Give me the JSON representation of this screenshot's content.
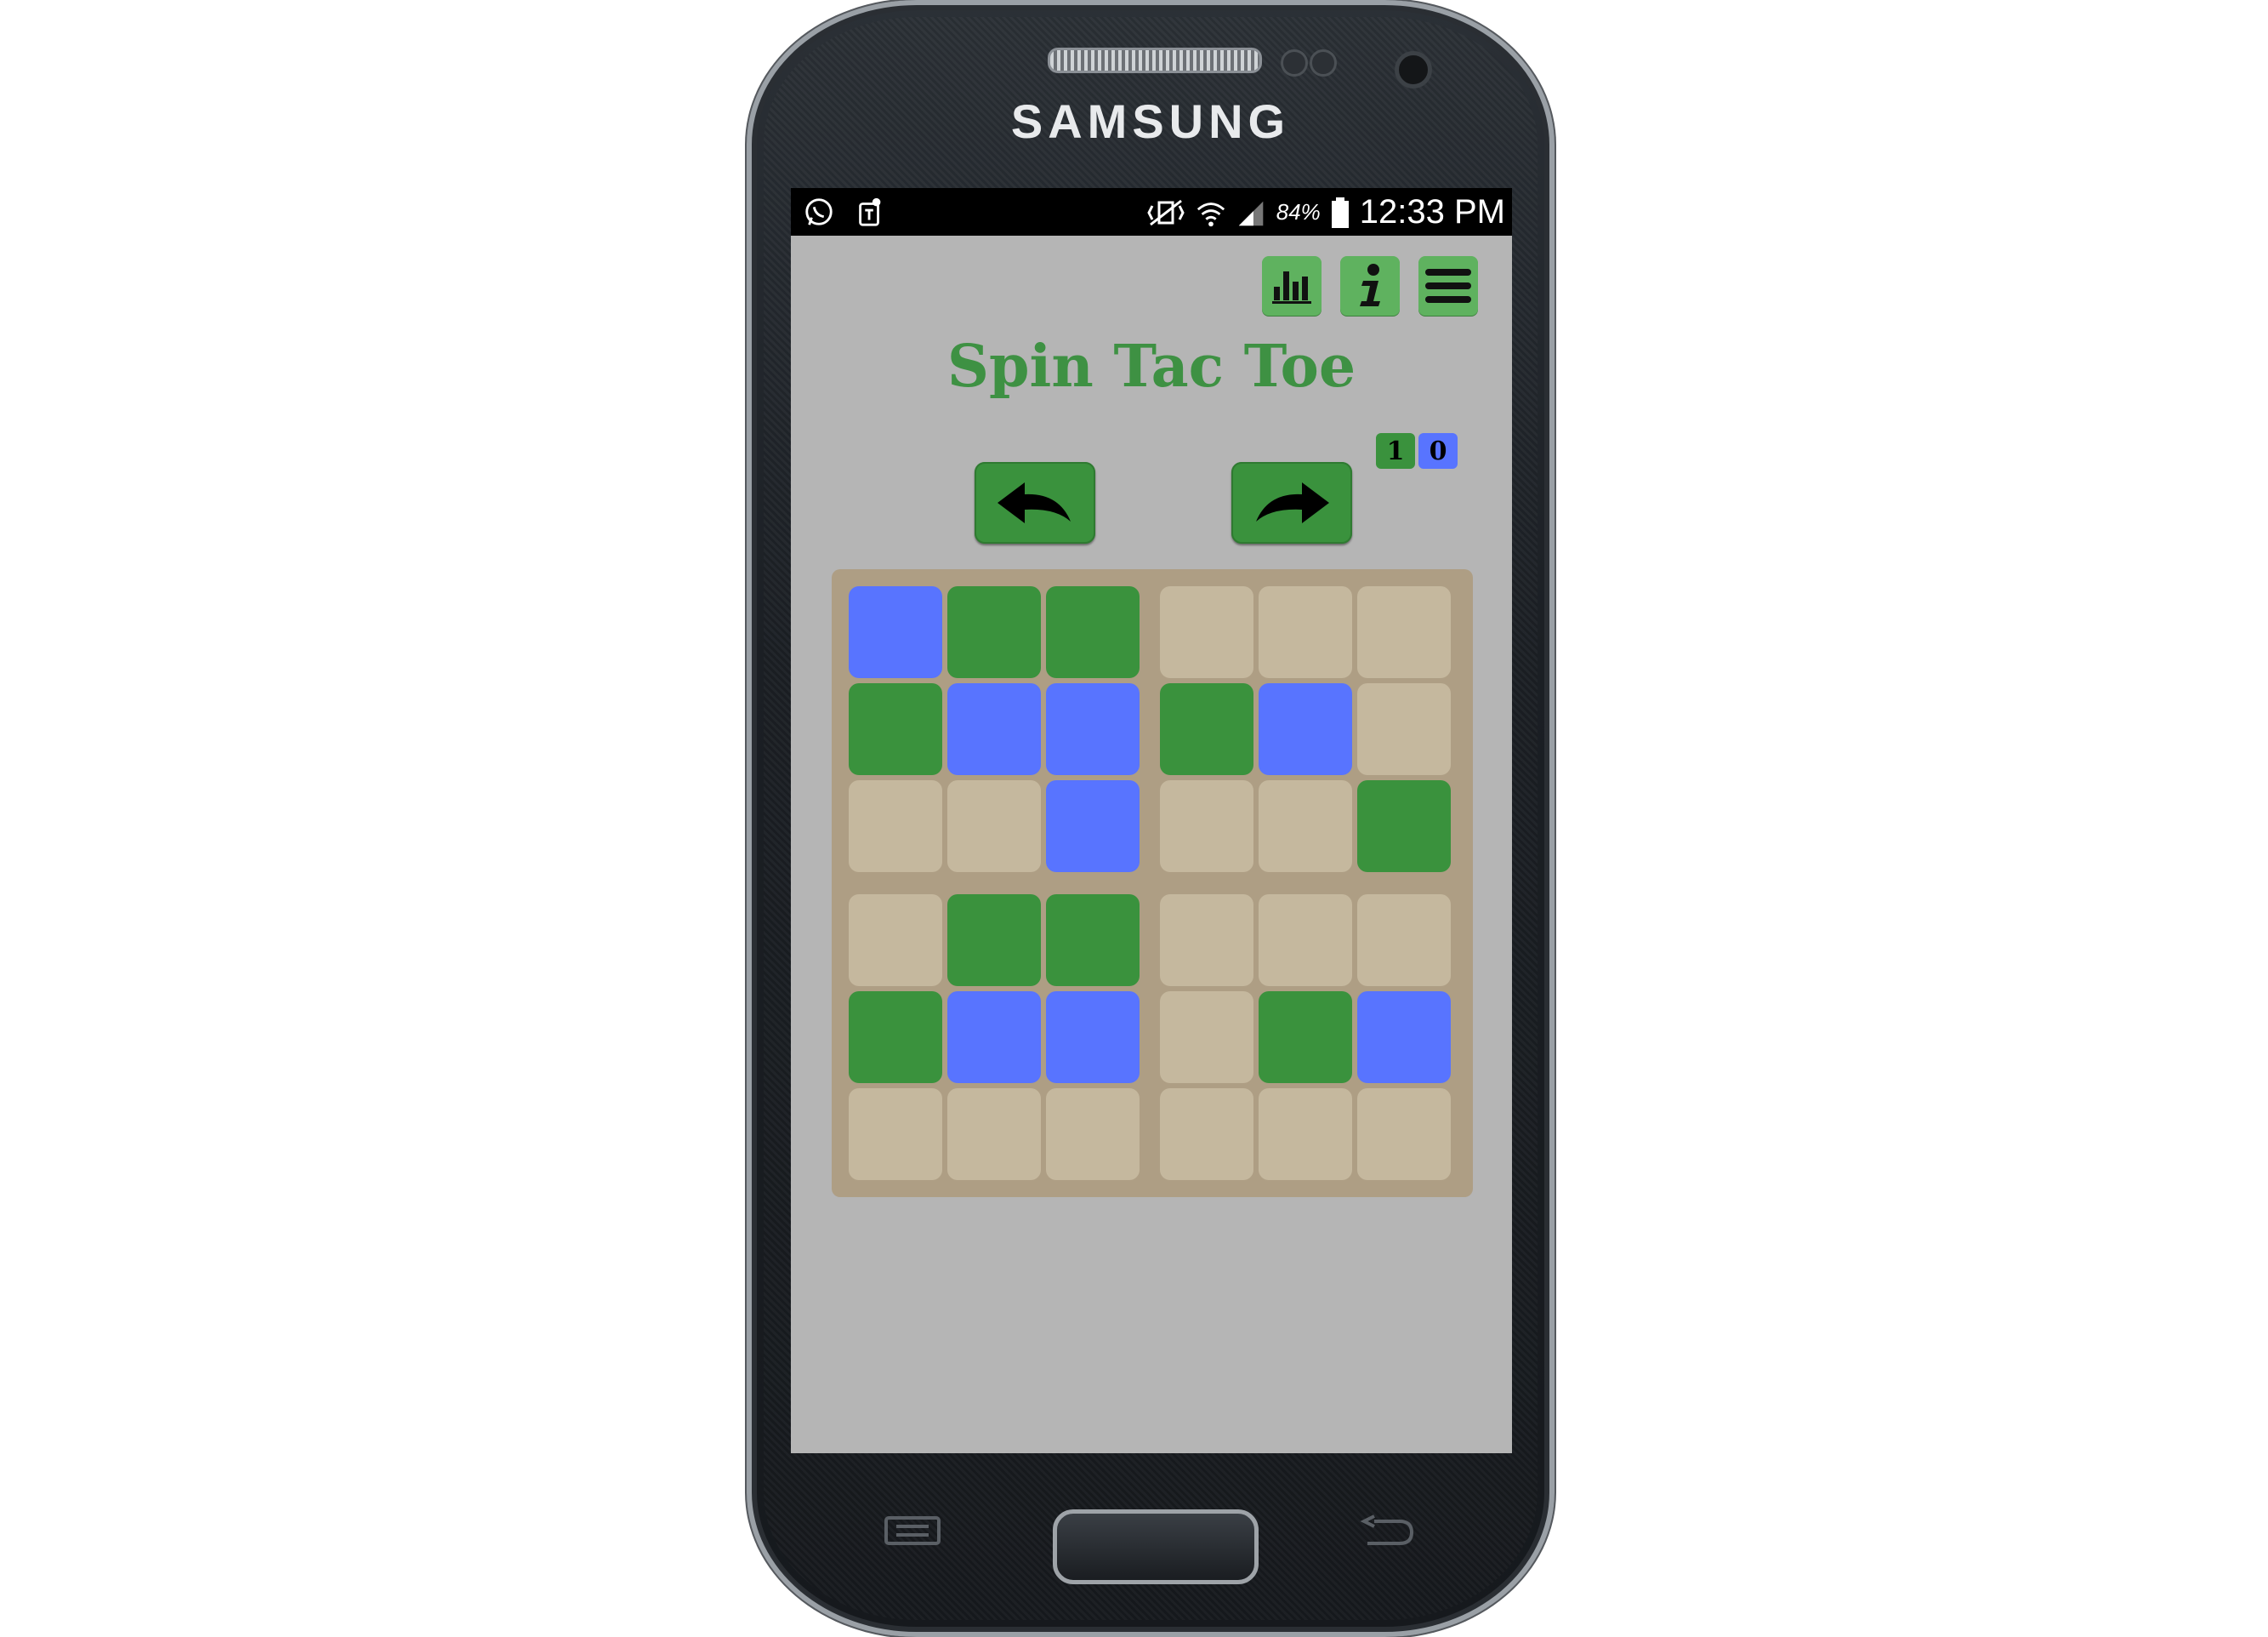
{
  "device": {
    "brand": "SAMSUNG"
  },
  "statusbar": {
    "left_icons": [
      "whatsapp-icon",
      "app-notification-icon"
    ],
    "right_icons": [
      "vibrate-mute-icon",
      "wifi-icon",
      "signal-icon",
      "battery-icon"
    ],
    "battery_percent": "84%",
    "time": "12:33 PM"
  },
  "toolbar": {
    "buttons": [
      {
        "name": "stats",
        "icon": "bar-chart-icon"
      },
      {
        "name": "info",
        "icon": "info-icon"
      },
      {
        "name": "menu",
        "icon": "hamburger-menu-icon"
      }
    ]
  },
  "app": {
    "title": "Spin Tac Toe"
  },
  "score": {
    "player1": "1",
    "player2": "0"
  },
  "nav": {
    "undo_icon": "undo-arrow-icon",
    "redo_icon": "redo-arrow-icon"
  },
  "board": {
    "rows": [
      [
        "blue",
        "green",
        "green",
        "empty",
        "empty",
        "empty"
      ],
      [
        "green",
        "blue",
        "blue",
        "green",
        "blue",
        "empty"
      ],
      [
        "empty",
        "empty",
        "blue",
        "empty",
        "empty",
        "green"
      ],
      [
        "empty",
        "green",
        "green",
        "empty",
        "empty",
        "empty"
      ],
      [
        "green",
        "blue",
        "blue",
        "empty",
        "green",
        "blue"
      ],
      [
        "empty",
        "empty",
        "empty",
        "empty",
        "empty",
        "empty"
      ]
    ]
  },
  "colors": {
    "background": "#b5b5b5",
    "player_green": "#3a923d",
    "player_blue": "#5874ff",
    "empty_cell": "#c5b89e",
    "board": "#ae9e84",
    "title": "#3e9143"
  }
}
